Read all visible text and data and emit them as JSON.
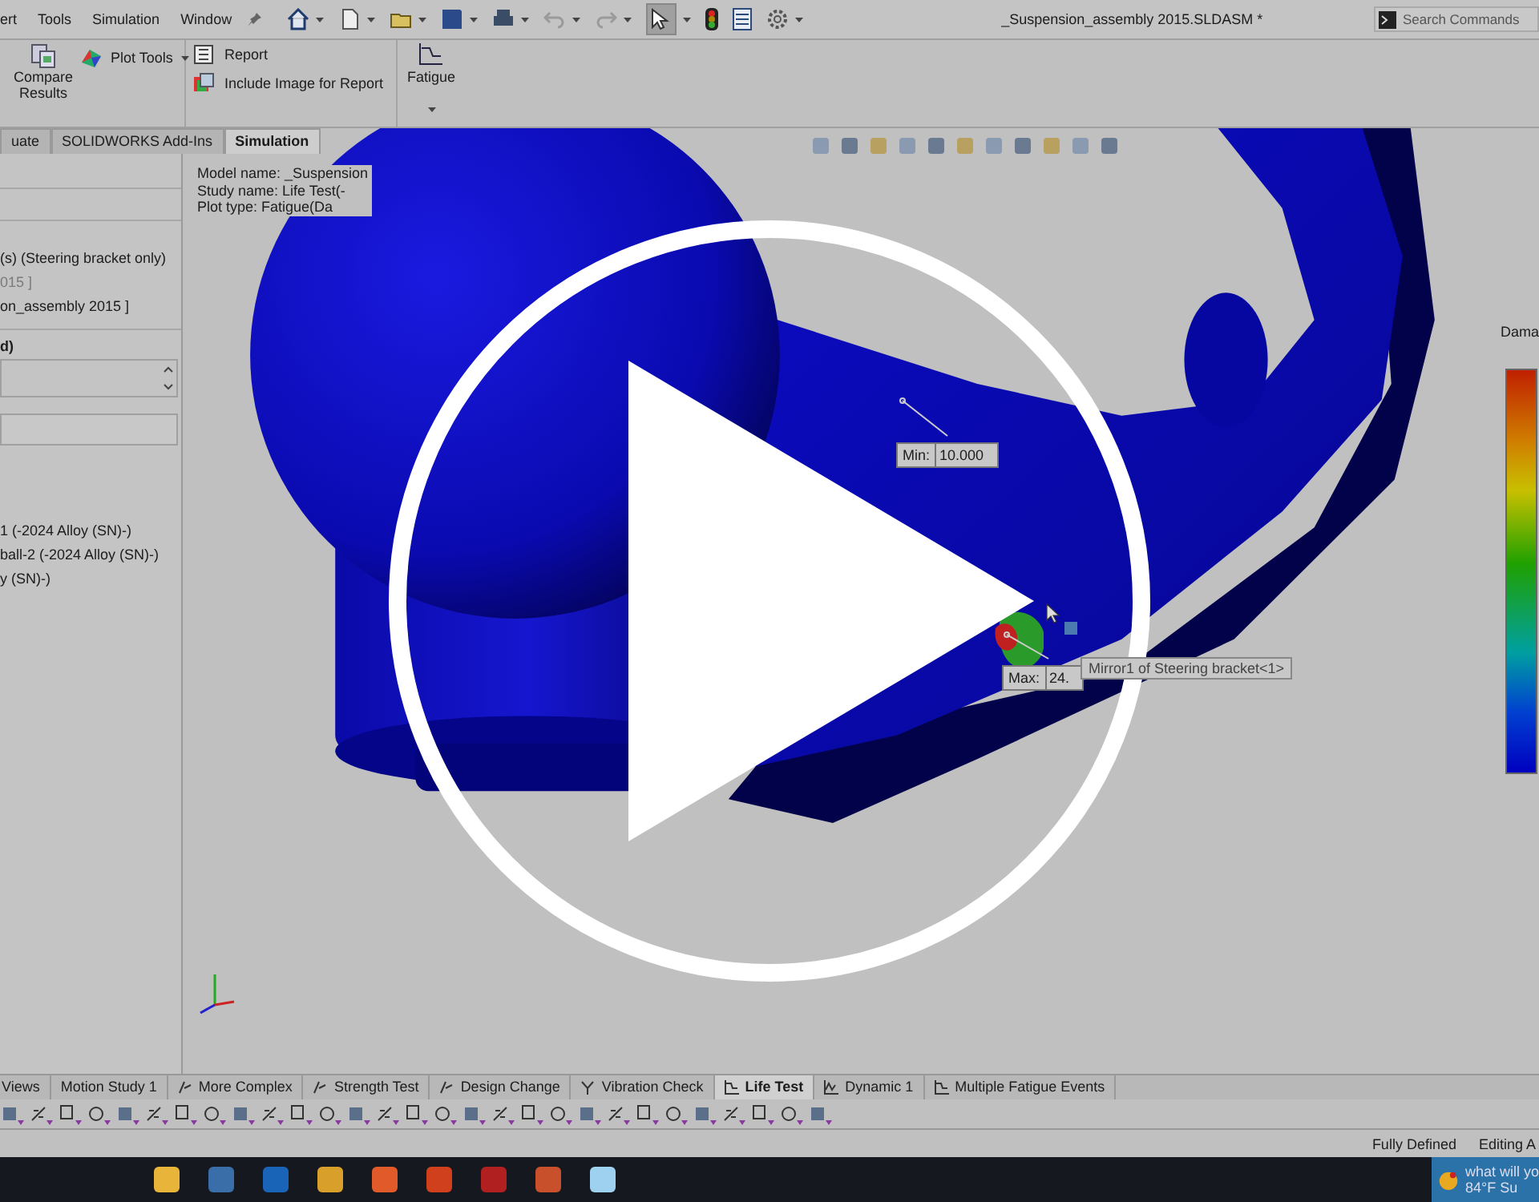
{
  "menu": [
    "ert",
    "Tools",
    "Simulation",
    "Window"
  ],
  "window": {
    "title": "_Suspension_assembly 2015.SLDASM *"
  },
  "search": {
    "placeholder": "Search Commands"
  },
  "ribbon": [
    {
      "kind": "large",
      "label": "Compare Results"
    },
    {
      "kind": "dropdown",
      "label": "Plot Tools"
    },
    {
      "kind": "report",
      "label": "Report"
    },
    {
      "kind": "image",
      "label": "Include Image for Report"
    },
    {
      "kind": "fatigue",
      "label": "Fatigue"
    }
  ],
  "tabs": [
    {
      "label": "uate",
      "selected": false
    },
    {
      "label": "SOLIDWORKS Add-Ins",
      "selected": false
    },
    {
      "label": "Simulation",
      "selected": true
    }
  ],
  "property_panel": [
    {
      "kind": "text",
      "text": "(s)  (Steering bracket only)"
    },
    {
      "kind": "dim",
      "text": "015 ]"
    },
    {
      "kind": "text",
      "text": "on_assembly 2015 ]"
    },
    {
      "kind": "heading",
      "text": "d)"
    },
    {
      "kind": "listbox"
    },
    {
      "kind": "field"
    },
    {
      "kind": "part",
      "text": "1 (-2024 Alloy (SN)-)"
    },
    {
      "kind": "text",
      "text": "ball-2 (-2024 Alloy (SN)-)"
    },
    {
      "kind": "text",
      "text": "y (SN)-)"
    }
  ],
  "viewport": {
    "info": [
      "Model name: _Suspension",
      "Study name: Life Test(-",
      "Plot type: Fatigue(Da"
    ],
    "min": {
      "label": "Min:",
      "value": "10.000"
    },
    "max": {
      "label": "Max:",
      "value": "24."
    },
    "tooltip": "Mirror1 of Steering bracket<1>",
    "legend_title": "Dama"
  },
  "study_tabs": [
    {
      "label": "Views",
      "kind": "plain",
      "selected": false
    },
    {
      "label": "Motion Study 1",
      "kind": "plain",
      "selected": false
    },
    {
      "label": "More Complex",
      "kind": "study",
      "selected": false
    },
    {
      "label": "Strength Test",
      "kind": "study",
      "selected": false
    },
    {
      "label": "Design Change",
      "kind": "study",
      "selected": false
    },
    {
      "label": "Vibration Check",
      "kind": "frequency",
      "selected": false
    },
    {
      "label": "Life Test",
      "kind": "fatigue",
      "selected": true
    },
    {
      "label": "Dynamic 1",
      "kind": "dynamic",
      "selected": false
    },
    {
      "label": "Multiple Fatigue Events",
      "kind": "fatigue",
      "selected": false
    }
  ],
  "status_bar": [
    "Fully Defined",
    "Editing A"
  ],
  "weather": {
    "headline": "what will yo",
    "reading": "84°F  Su"
  }
}
